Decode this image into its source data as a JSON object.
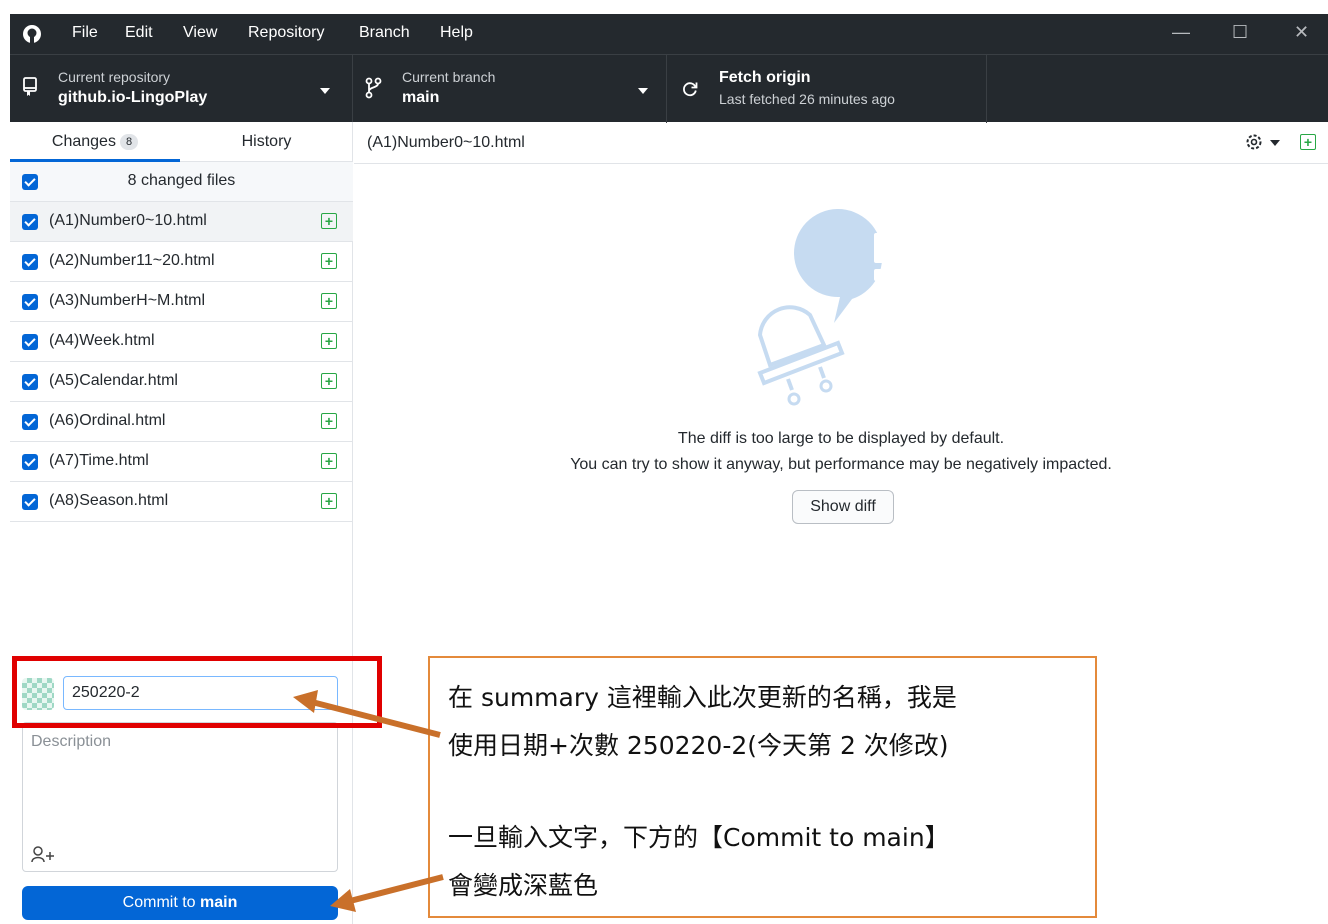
{
  "menu": {
    "items": [
      "File",
      "Edit",
      "View",
      "Repository",
      "Branch",
      "Help"
    ]
  },
  "window_controls": {
    "minimize": "—",
    "maximize": "☐",
    "close": "✕"
  },
  "toolbar": {
    "repo_label": "Current repository",
    "repo_name": "github.io-LingoPlay",
    "branch_label": "Current branch",
    "branch_name": "main",
    "fetch_title": "Fetch origin",
    "fetch_status": "Last fetched 26 minutes ago"
  },
  "tabs": {
    "changes_label": "Changes",
    "changes_count": "8",
    "history_label": "History"
  },
  "changes": {
    "summary_label": "8 changed files",
    "files": [
      "(A1)Number0~10.html",
      "(A2)Number11~20.html",
      "(A3)NumberH~M.html",
      "(A4)Week.html",
      "(A5)Calendar.html",
      "(A6)Ordinal.html",
      "(A7)Time.html",
      "(A8)Season.html"
    ]
  },
  "content": {
    "selected_file": "(A1)Number0~10.html",
    "message_line1": "The diff is too large to be displayed by default.",
    "message_line2": "You can try to show it anyway, but performance may be negatively impacted.",
    "show_diff_label": "Show diff"
  },
  "commit": {
    "summary_value": "250220-2",
    "description_placeholder": "Description",
    "button_prefix": "Commit to ",
    "button_branch": "main"
  },
  "annotation": {
    "line1": "在 summary 這裡輸入此次更新的名稱，我是",
    "line2": "使用日期+次數  250220-2(今天第 2 次修改)",
    "line3": "一旦輸入文字，下方的【Commit to main】",
    "line4": "會變成深藍色"
  },
  "colors": {
    "titlebar": "#24292e",
    "accent": "#0366d6",
    "added": "#28a745",
    "highlight_box": "#e00000",
    "callout_border": "#e48a3b",
    "arrow": "#c9702a"
  }
}
